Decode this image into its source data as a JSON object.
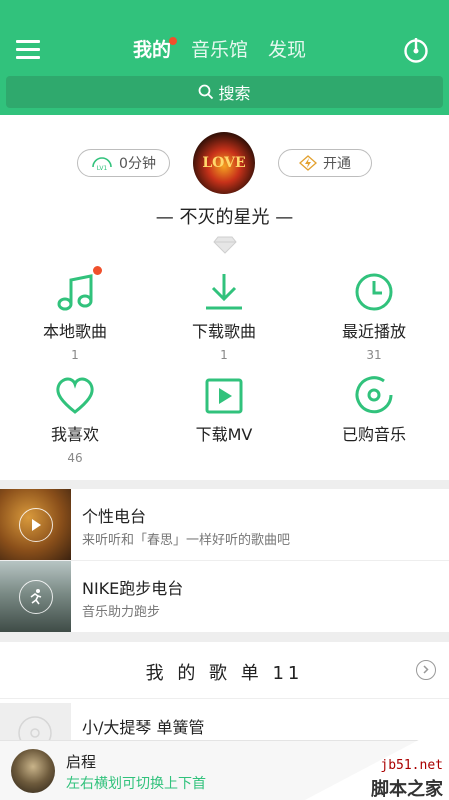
{
  "header": {
    "tabs": [
      {
        "label": "我的",
        "active": true,
        "badge": true
      },
      {
        "label": "音乐馆",
        "active": false
      },
      {
        "label": "发现",
        "active": false
      }
    ],
    "search_label": "搜索",
    "accent_color": "#31c27c"
  },
  "profile": {
    "listen_pill": "0分钟",
    "level_icon": "level-lv1-icon",
    "vip_pill": "开通",
    "avatar_text": "LOVE",
    "username": "— 不灭的星光 —"
  },
  "quick_grid": [
    {
      "label": "本地歌曲",
      "count": "1",
      "icon": "music-note-icon"
    },
    {
      "label": "下载歌曲",
      "count": "1",
      "icon": "download-icon"
    },
    {
      "label": "最近播放",
      "count": "31",
      "icon": "clock-icon"
    },
    {
      "label": "我喜欢",
      "count": "46",
      "icon": "heart-icon"
    },
    {
      "label": "下载MV",
      "count": "",
      "icon": "video-play-icon"
    },
    {
      "label": "已购音乐",
      "count": "",
      "icon": "disc-icon"
    }
  ],
  "radios": [
    {
      "title": "个性电台",
      "subtitle": "来听听和「春思」一样好听的歌曲吧"
    },
    {
      "title": "NIKE跑步电台",
      "subtitle": "音乐助力跑步"
    }
  ],
  "playlists": {
    "header": "我 的 歌 单  11",
    "items": [
      {
        "name": "小/大提琴 单簧管"
      }
    ]
  },
  "player": {
    "title": "启程",
    "subtitle": "左右横划可切换上下首"
  },
  "watermark": {
    "url": "jb51.net",
    "name": "脚本之家"
  }
}
